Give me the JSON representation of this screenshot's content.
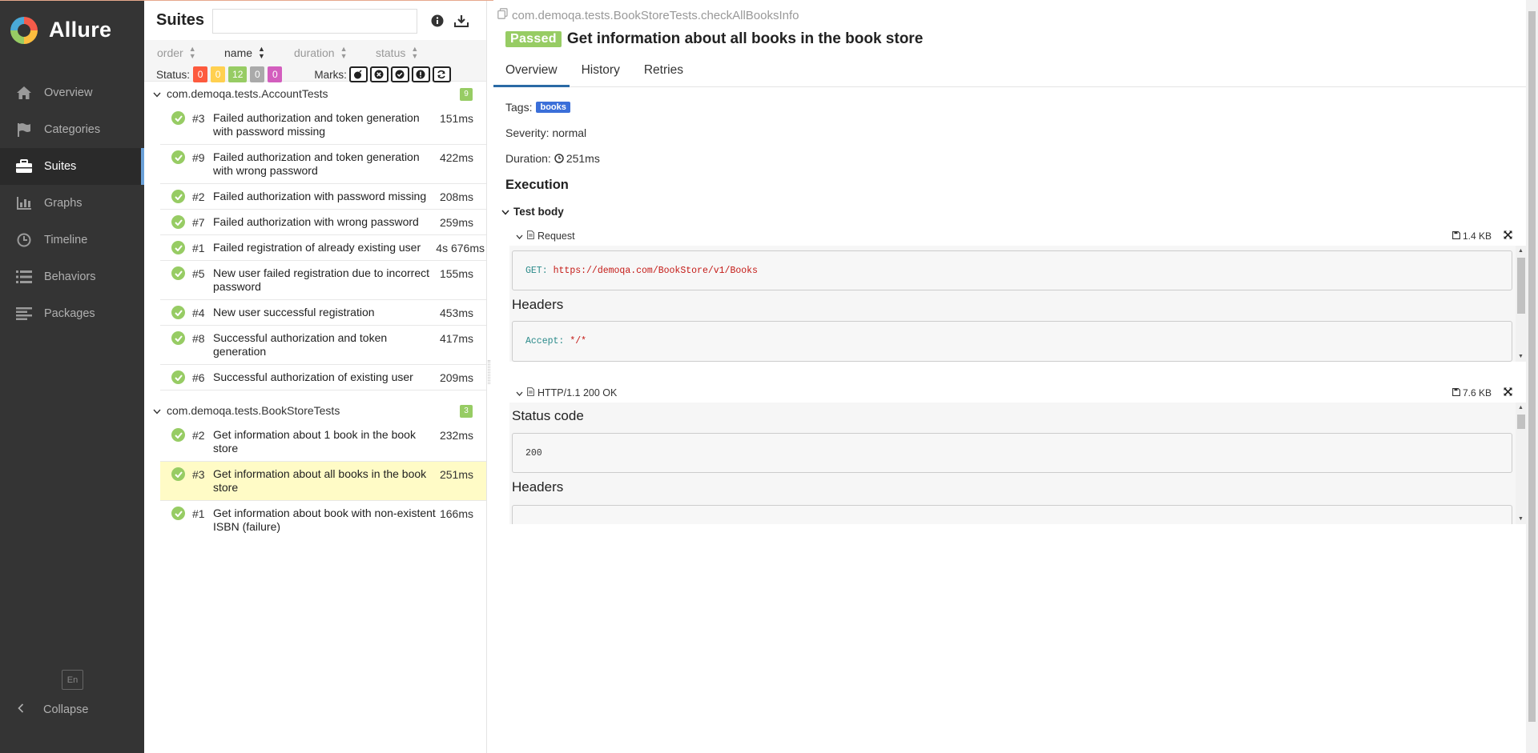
{
  "sidebar": {
    "brand": "Allure",
    "items": [
      {
        "label": "Overview",
        "icon": "home-icon"
      },
      {
        "label": "Categories",
        "icon": "flag-icon"
      },
      {
        "label": "Suites",
        "icon": "briefcase-icon",
        "active": true
      },
      {
        "label": "Graphs",
        "icon": "bar-chart-icon"
      },
      {
        "label": "Timeline",
        "icon": "clock-icon"
      },
      {
        "label": "Behaviors",
        "icon": "list-icon"
      },
      {
        "label": "Packages",
        "icon": "align-left-icon"
      }
    ],
    "language": "En",
    "collapse_label": "Collapse"
  },
  "suites_panel": {
    "title": "Suites",
    "search_value": "",
    "sort": {
      "order": "order",
      "name": "name",
      "duration": "duration",
      "status": "status"
    },
    "status_label": "Status:",
    "status_counts": [
      {
        "value": "0",
        "color": "#fd5a3e"
      },
      {
        "value": "0",
        "color": "#ffd050"
      },
      {
        "value": "12",
        "color": "#97cc64"
      },
      {
        "value": "0",
        "color": "#aaaaaa"
      },
      {
        "value": "0",
        "color": "#d35ebe"
      }
    ],
    "marks_label": "Marks:",
    "suites": [
      {
        "name": "com.demoqa.tests.AccountTests",
        "count": "9",
        "tests": [
          {
            "num": "#3",
            "name": "Failed authorization and token generation with password missing",
            "duration": "151ms"
          },
          {
            "num": "#9",
            "name": "Failed authorization and token generation with wrong password",
            "duration": "422ms"
          },
          {
            "num": "#2",
            "name": "Failed authorization with password missing",
            "duration": "208ms"
          },
          {
            "num": "#7",
            "name": "Failed authorization with wrong password",
            "duration": "259ms"
          },
          {
            "num": "#1",
            "name": "Failed registration of already existing user",
            "duration": "4s 676ms"
          },
          {
            "num": "#5",
            "name": "New user failed registration due to incorrect password",
            "duration": "155ms"
          },
          {
            "num": "#4",
            "name": "New user successful registration",
            "duration": "453ms"
          },
          {
            "num": "#8",
            "name": "Successful authorization and token generation",
            "duration": "417ms"
          },
          {
            "num": "#6",
            "name": "Successful authorization of existing user",
            "duration": "209ms"
          }
        ]
      },
      {
        "name": "com.demoqa.tests.BookStoreTests",
        "count": "3",
        "tests": [
          {
            "num": "#2",
            "name": "Get information about 1 book in the book store",
            "duration": "232ms"
          },
          {
            "num": "#3",
            "name": "Get information about all books in the book store",
            "duration": "251ms",
            "selected": true
          },
          {
            "num": "#1",
            "name": "Get information about book with non-existent ISBN (failure)",
            "duration": "166ms"
          }
        ]
      }
    ]
  },
  "detail": {
    "breadcrumb": "com.demoqa.tests.BookStoreTests.checkAllBooksInfo",
    "status": "Passed",
    "title": "Get information about all books in the book store",
    "tabs": [
      "Overview",
      "History",
      "Retries"
    ],
    "tags_label": "Tags:",
    "tag": "books",
    "severity_label": "Severity: normal",
    "duration_label": "Duration:",
    "duration": "251ms",
    "execution_title": "Execution",
    "test_body_label": "Test body",
    "request": {
      "label": "Request",
      "size": "1.4 KB",
      "method": "GET:",
      "url": "https://demoqa.com/BookStore/v1/Books",
      "headers_title": "Headers",
      "header_key": "Accept:",
      "header_value": "*/*"
    },
    "response": {
      "label": "HTTP/1.1 200 OK",
      "size": "7.6 KB",
      "status_title": "Status code",
      "status_code": "200",
      "headers_title": "Headers"
    }
  },
  "colors": {
    "sidebar_bg": "#343434",
    "passed": "#97cc64",
    "tag": "#3b6fd9",
    "selected_row": "#fffbc6"
  }
}
